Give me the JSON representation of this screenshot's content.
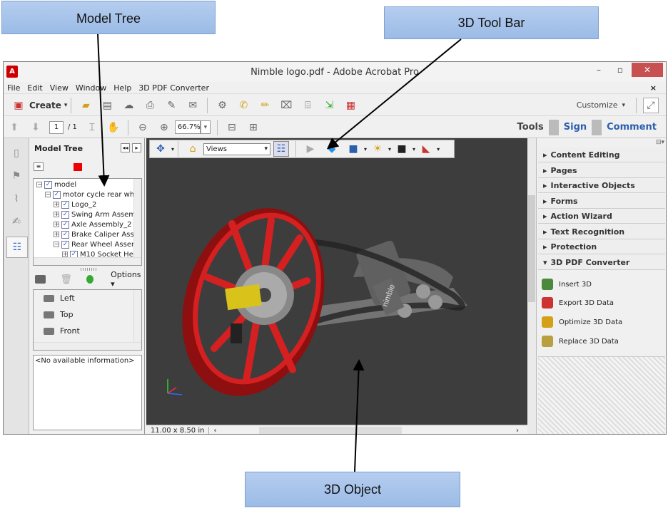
{
  "callouts": {
    "model_tree": "Model Tree",
    "tool_bar": "3D Tool Bar",
    "object": "3D Object"
  },
  "window": {
    "title": "Nimble logo.pdf - Adobe Acrobat Pro"
  },
  "menu": [
    "File",
    "Edit",
    "View",
    "Window",
    "Help",
    "3D PDF Converter"
  ],
  "toolbar": {
    "create_label": "Create",
    "customize_label": "Customize"
  },
  "nav": {
    "page_current": "1",
    "page_total": "/ 1",
    "zoom": "66.7%"
  },
  "right_tabs": {
    "tools": "Tools",
    "sign": "Sign",
    "comment": "Comment"
  },
  "model_tree": {
    "title": "Model Tree",
    "options_label": "Options",
    "no_info": "<No available information>",
    "items": [
      "model",
      "motor cycle rear whe",
      "Logo_2",
      "Swing Arm Assem",
      "Axle Assembly_2",
      "Brake Caliper Asse",
      "Rear Wheel Assen",
      "M10 Socket He"
    ],
    "views": [
      "Left",
      "Top",
      "Front"
    ]
  },
  "viewer": {
    "views_select": "Views",
    "page_size": "11.00 x 8.50 in",
    "logo_text": "nimble"
  },
  "tools_panel": {
    "sections": [
      "Content Editing",
      "Pages",
      "Interactive Objects",
      "Forms",
      "Action Wizard",
      "Text Recognition",
      "Protection",
      "3D PDF Converter"
    ],
    "converter_tools": [
      "Insert 3D",
      "Export 3D Data",
      "Optimize 3D Data",
      "Replace 3D Data"
    ]
  },
  "colors": {
    "accent_blue": "#2b5fad",
    "close_red": "#c75050",
    "wheel_red": "#d42020",
    "viewer_bg": "#3d3d3d"
  }
}
